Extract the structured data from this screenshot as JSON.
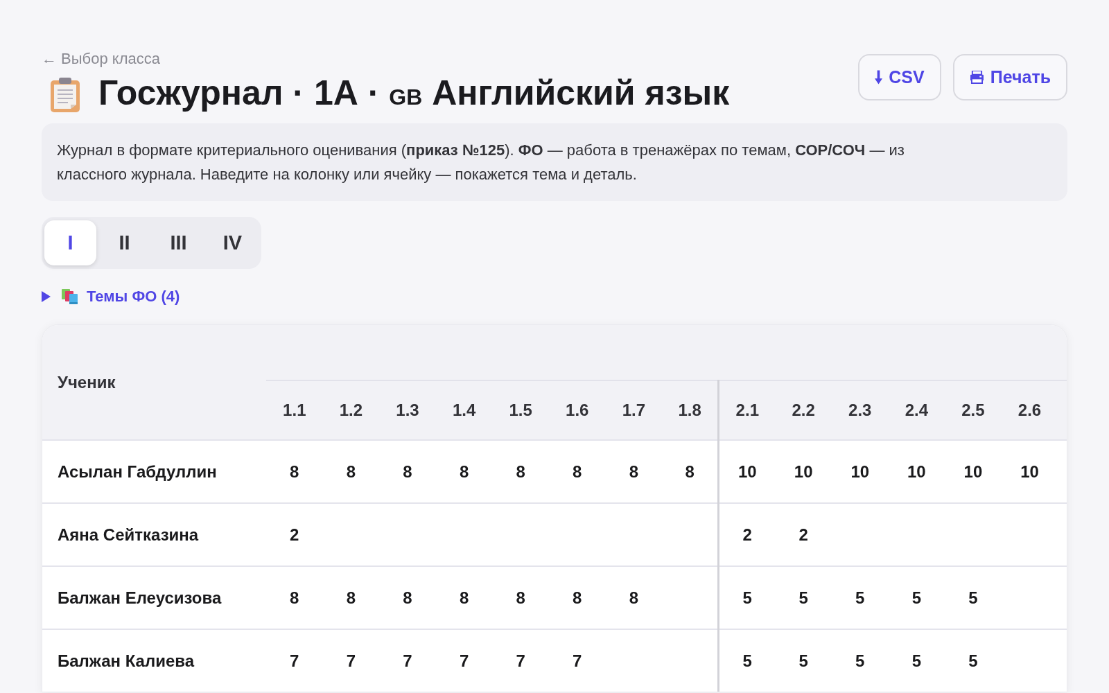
{
  "back_link": "← Выбор класса",
  "title": {
    "text": "Госжурнал · 1А ·",
    "flag": "GB",
    "subject": "Английский язык"
  },
  "actions": [
    {
      "kind": "download",
      "label": "CSV"
    },
    {
      "kind": "print",
      "label": "Печать"
    }
  ],
  "info": "Журнал в формате критериального оценивания (**приказ №125**). **ФО** — работа в тренажёрах по темам, **СОР/СОЧ** — из классного журнала. Наведите на колонку или ячейку — покажется тема и деталь.",
  "terms": [
    {
      "label": "I",
      "selected": true
    },
    {
      "label": "II",
      "selected": false
    },
    {
      "label": "III",
      "selected": false
    },
    {
      "label": "IV",
      "selected": false
    }
  ],
  "topics": {
    "label": "Темы ФО (4)",
    "expanded": false
  },
  "table": {
    "name_header": "Ученик",
    "groups": [
      {
        "columns": [
          "1.1",
          "1.2",
          "1.3",
          "1.4",
          "1.5",
          "1.6",
          "1.7",
          "1.8"
        ]
      },
      {
        "columns": [
          "2.1",
          "2.2",
          "2.3",
          "2.4",
          "2.5",
          "2.6"
        ]
      }
    ],
    "rows": [
      {
        "name": "Асылан Габдуллин",
        "scores": [
          [
            "8",
            "8",
            "8",
            "8",
            "8",
            "8",
            "8",
            "8"
          ],
          [
            "10",
            "10",
            "10",
            "10",
            "10",
            "10"
          ]
        ]
      },
      {
        "name": "Аяна Сейтказина",
        "scores": [
          [
            "2"
          ],
          [
            "2",
            "2"
          ]
        ]
      },
      {
        "name": "Балжан Елеусизова",
        "scores": [
          [
            "8",
            "8",
            "8",
            "8",
            "8",
            "8",
            "8"
          ],
          [
            "5",
            "5",
            "5",
            "5",
            "5"
          ]
        ]
      },
      {
        "name": "Балжан Калиева",
        "scores": [
          [
            "7",
            "7",
            "7",
            "7",
            "7",
            "7"
          ],
          [
            "5",
            "5",
            "5",
            "5",
            "5"
          ]
        ]
      }
    ]
  }
}
